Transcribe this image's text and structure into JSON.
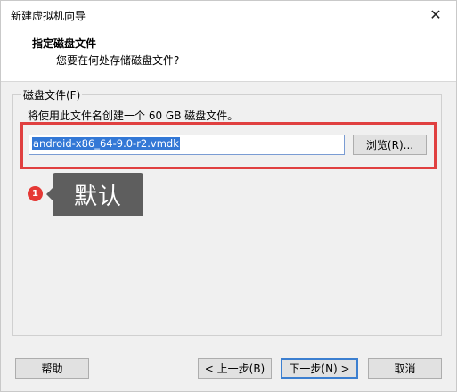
{
  "window": {
    "title": "新建虚拟机向导"
  },
  "header": {
    "title": "指定磁盘文件",
    "subtitle": "您要在何处存储磁盘文件?"
  },
  "disk_group": {
    "label": "磁盘文件(F)",
    "description": "将使用此文件名创建一个 60 GB 磁盘文件。",
    "file_value": "android-x86_64-9.0-r2.vmdk",
    "browse_label": "浏览(R)..."
  },
  "annotation": {
    "step_number": "1",
    "text": "默认",
    "highlight_color": "#e04040",
    "badge_color": "#e53935"
  },
  "footer": {
    "help_label": "帮助",
    "back_label": "< 上一步(B)",
    "next_label": "下一步(N) >",
    "cancel_label": "取消"
  },
  "icons": {
    "close": "close-icon"
  }
}
